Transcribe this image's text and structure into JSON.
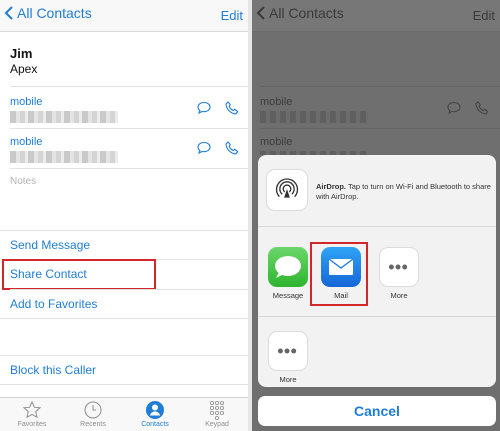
{
  "left": {
    "nav": {
      "back_label": "All Contacts",
      "edit_label": "Edit"
    },
    "contact": {
      "name": "Jim",
      "company": "Apex"
    },
    "phones": [
      {
        "label": "mobile"
      },
      {
        "label": "mobile"
      }
    ],
    "notes_placeholder": "Notes",
    "actions": {
      "send_message": "Send Message",
      "share_contact": "Share Contact",
      "add_favorites": "Add to Favorites",
      "block_caller": "Block this Caller"
    },
    "tabs": [
      {
        "label": "Favorites",
        "icon": "star-icon"
      },
      {
        "label": "Recents",
        "icon": "clock-icon"
      },
      {
        "label": "Contacts",
        "icon": "person-icon"
      },
      {
        "label": "Keypad",
        "icon": "keypad-icon"
      }
    ]
  },
  "right": {
    "nav": {
      "back_label": "All Contacts",
      "edit_label": "Edit"
    },
    "phones": [
      {
        "label": "mobile"
      },
      {
        "label": "mobile"
      }
    ],
    "airdrop": {
      "title": "AirDrop.",
      "text": "Tap to turn on Wi-Fi and Bluetooth to share with AirDrop."
    },
    "apps": [
      {
        "label": "Message",
        "icon": "message-icon"
      },
      {
        "label": "Mail",
        "icon": "mail-icon"
      },
      {
        "label": "More",
        "icon": "more-icon"
      }
    ],
    "actions": [
      {
        "label": "More",
        "icon": "more-icon"
      }
    ],
    "cancel_label": "Cancel"
  },
  "colors": {
    "accent": "#1f7dd6",
    "highlight": "#d2262b"
  }
}
